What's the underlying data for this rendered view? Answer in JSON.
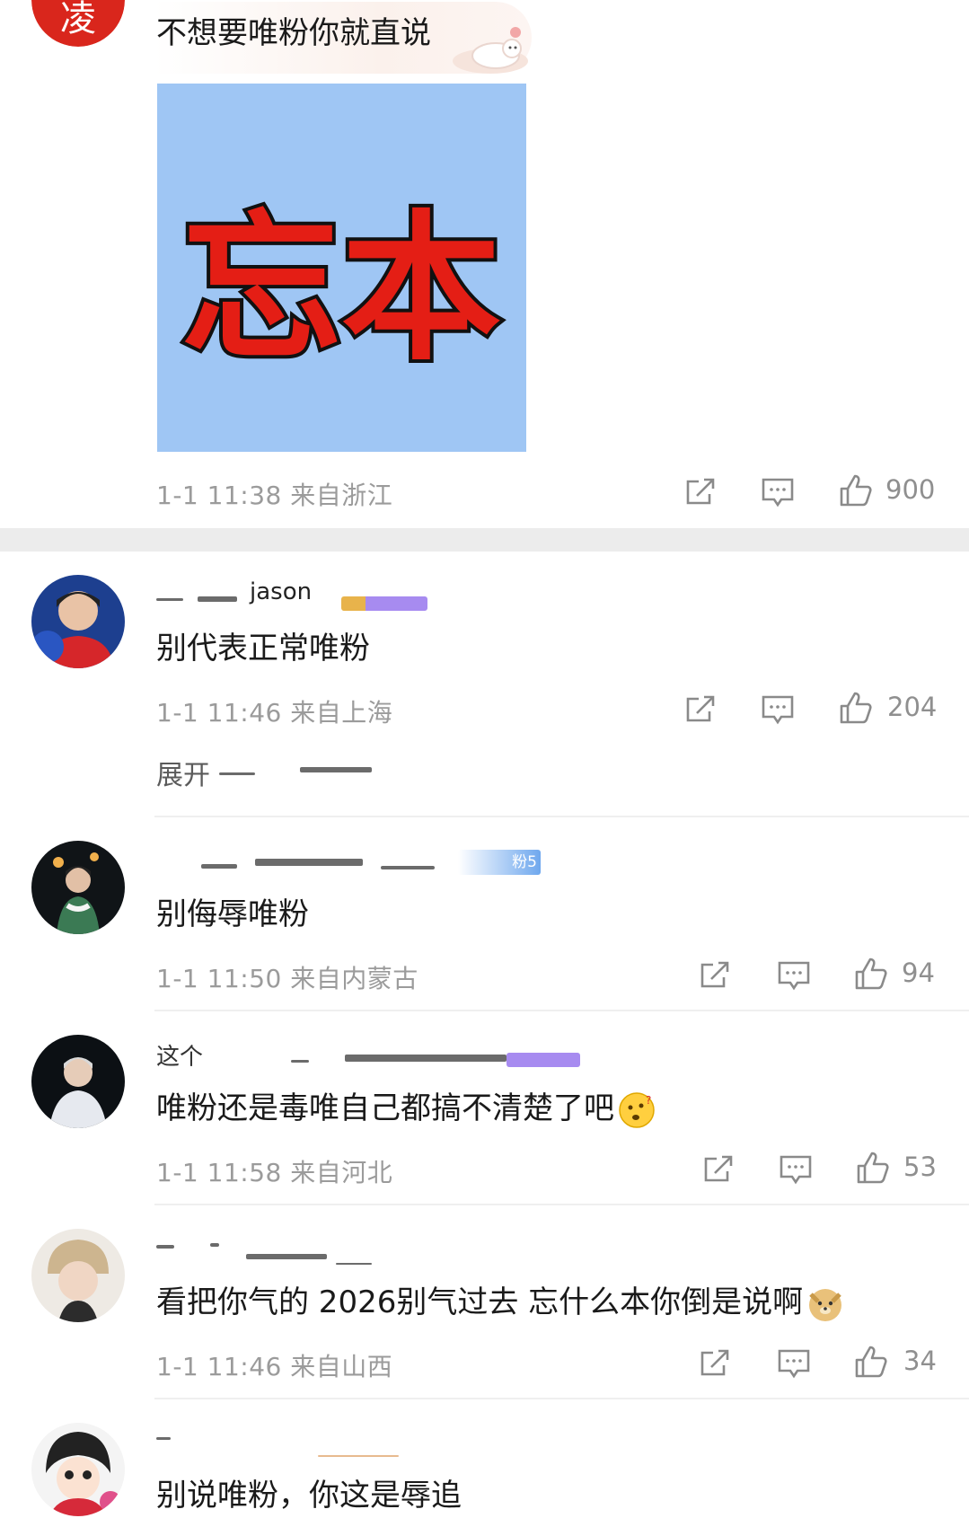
{
  "comments": [
    {
      "avatar_char": "凌",
      "text": "不想要唯粉你就直说",
      "image_text": "忘本",
      "meta": "1-1 11:38  来自浙江",
      "likes": "900"
    },
    {
      "username": "jason",
      "text": "别代表正常唯粉",
      "meta": "1-1 11:46  来自上海",
      "likes": "204",
      "reply_preview": "展开"
    },
    {
      "badge": "粉5",
      "text": "别侮辱唯粉",
      "meta": "1-1 11:50  来自内蒙古",
      "likes": "94"
    },
    {
      "username": "这个",
      "text": "唯粉还是毒唯自己都搞不清楚了吧",
      "meta": "1-1 11:58  来自河北",
      "likes": "53"
    },
    {
      "text": "看把你气的 2026别气过去 忘什么本你倒是说啊",
      "meta": "1-1 11:46  来自山西",
      "likes": "34"
    },
    {
      "text": "别说唯粉，你这是辱追"
    }
  ],
  "icons": {
    "share": "share-icon",
    "comment": "comment-icon",
    "like": "like-icon"
  },
  "colors": {
    "avatar_red": "#d9261c",
    "image_bg": "#9fc6f4",
    "image_text": "#e41e15",
    "meta_gray": "#9b9b9b",
    "badge_purple": "#a78bf0",
    "badge_blue": "#6fa8ee"
  }
}
